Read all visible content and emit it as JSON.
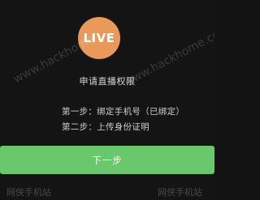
{
  "badge": {
    "label": "LIVE",
    "color": "#e99a5b"
  },
  "title": "申请直播权限",
  "steps": [
    "第一步：绑定手机号（已绑定）",
    "第二步：上传身份证明"
  ],
  "next_button": {
    "label": "下一步",
    "color": "#69c86b"
  },
  "watermarks": {
    "url_left": "www.hackhome",
    "url_right": "www.hackhome.com",
    "cn_left": "网侠手机站",
    "cn_right": "网侠手机站"
  }
}
